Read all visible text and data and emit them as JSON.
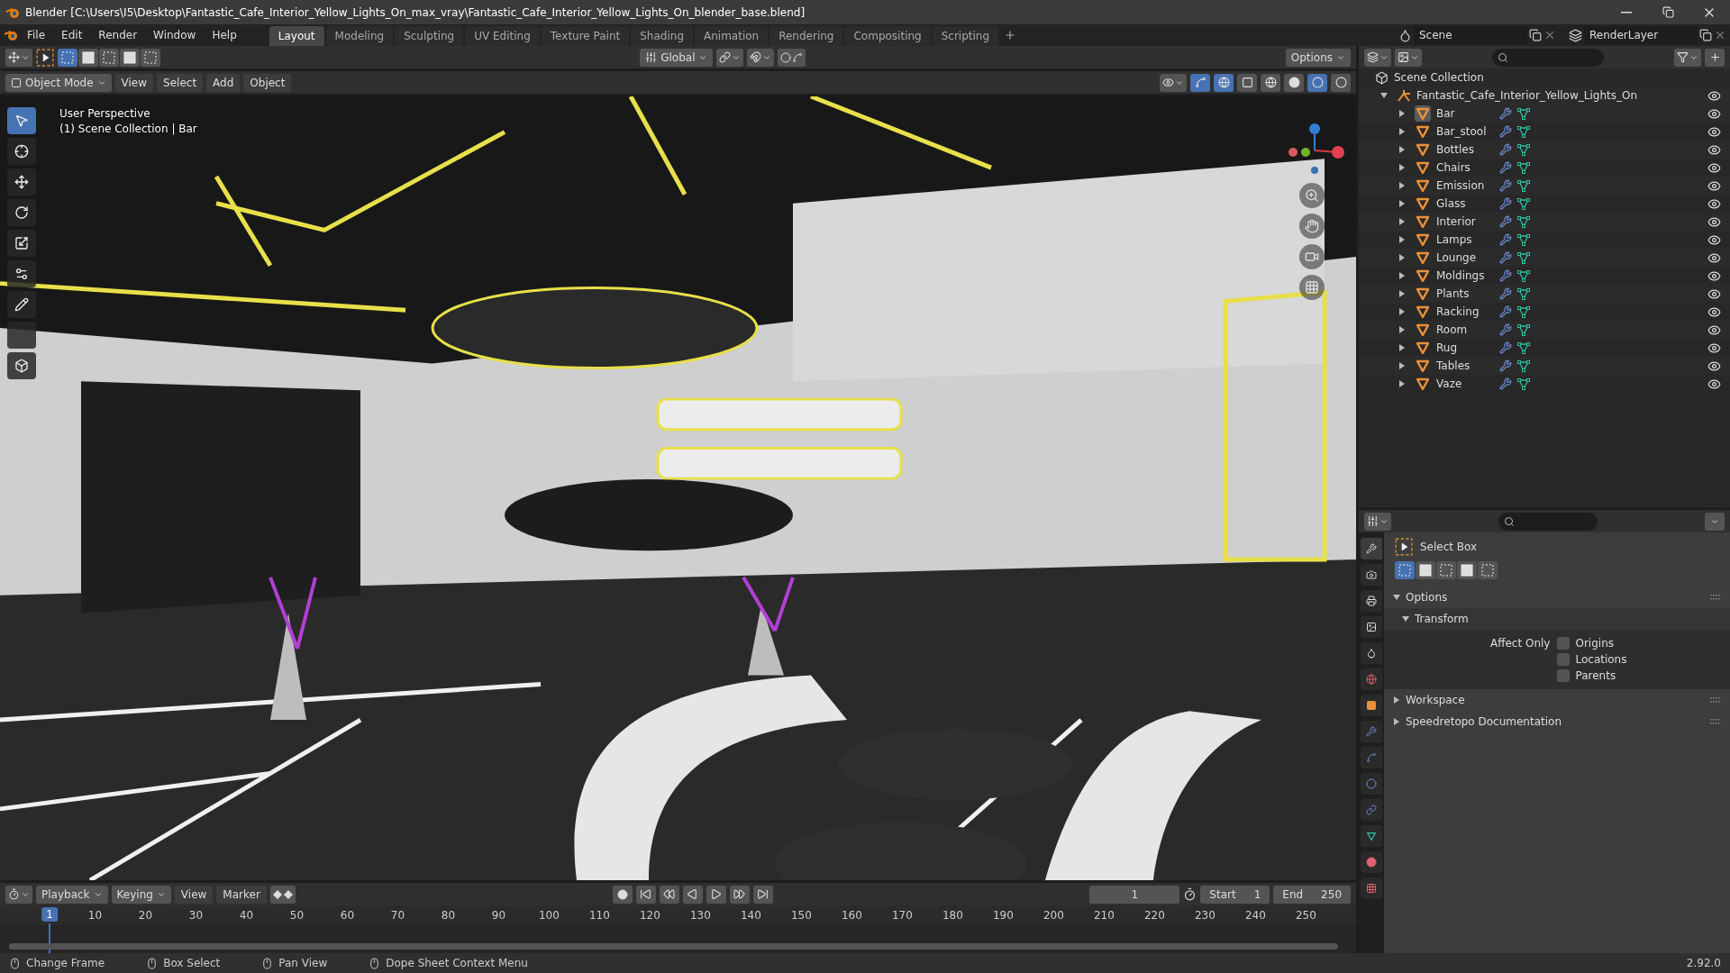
{
  "window": {
    "title": "Blender [C:\\Users\\I5\\Desktop\\Fantastic_Cafe_Interior_Yellow_Lights_On_max_vray\\Fantastic_Cafe_Interior_Yellow_Lights_On_blender_base.blend]"
  },
  "menu": [
    "File",
    "Edit",
    "Render",
    "Window",
    "Help"
  ],
  "workspaces": [
    {
      "label": "Layout",
      "selected": true
    },
    {
      "label": "Modeling",
      "selected": false
    },
    {
      "label": "Sculpting",
      "selected": false
    },
    {
      "label": "UV Editing",
      "selected": false
    },
    {
      "label": "Texture Paint",
      "selected": false
    },
    {
      "label": "Shading",
      "selected": false
    },
    {
      "label": "Animation",
      "selected": false
    },
    {
      "label": "Rendering",
      "selected": false
    },
    {
      "label": "Compositing",
      "selected": false
    },
    {
      "label": "Scripting",
      "selected": false
    }
  ],
  "scene": "Scene",
  "view_layer": "RenderLayer",
  "tool_header": {
    "orientation": "Global",
    "options": "Options"
  },
  "viewport": {
    "mode": "Object Mode",
    "menus": [
      "View",
      "Select",
      "Add",
      "Object"
    ],
    "view_name": "User Perspective",
    "context": "(1) Scene Collection | Bar"
  },
  "outliner": {
    "root": "Scene Collection",
    "collection": {
      "name": "Fantastic_Cafe_Interior_Yellow_Lights_On",
      "expanded": true,
      "children": [
        {
          "name": "Bar",
          "selected": true
        },
        {
          "name": "Bar_stool",
          "selected": false
        },
        {
          "name": "Bottles",
          "selected": false
        },
        {
          "name": "Chairs",
          "selected": false
        },
        {
          "name": "Emission",
          "selected": false
        },
        {
          "name": "Glass",
          "selected": false
        },
        {
          "name": "Interior",
          "selected": false
        },
        {
          "name": "Lamps",
          "selected": false
        },
        {
          "name": "Lounge",
          "selected": false
        },
        {
          "name": "Moldings",
          "selected": false
        },
        {
          "name": "Plants",
          "selected": false
        },
        {
          "name": "Racking",
          "selected": false
        },
        {
          "name": "Room",
          "selected": false
        },
        {
          "name": "Rug",
          "selected": false
        },
        {
          "name": "Tables",
          "selected": false
        },
        {
          "name": "Vaze",
          "selected": false
        }
      ]
    }
  },
  "properties": {
    "tool": "Select Box",
    "panels": [
      {
        "title": "Options",
        "expanded": true,
        "subpanels": [
          {
            "title": "Transform",
            "expanded": true,
            "label": "Affect Only",
            "checkboxes": [
              {
                "label": "Origins",
                "checked": false
              },
              {
                "label": "Locations",
                "checked": false
              },
              {
                "label": "Parents",
                "checked": false
              }
            ]
          }
        ]
      },
      {
        "title": "Workspace",
        "expanded": false
      },
      {
        "title": "Speedretopo Documentation",
        "expanded": false
      }
    ]
  },
  "timeline": {
    "menus": [
      {
        "label": "Playback",
        "kind": "dropdown"
      },
      {
        "label": "Keying",
        "kind": "dropdown"
      },
      {
        "label": "View",
        "kind": "menu"
      },
      {
        "label": "Marker",
        "kind": "menu"
      }
    ],
    "current_frame": "1",
    "start_label": "Start",
    "start": "1",
    "end_label": "End",
    "end": "250",
    "playhead": "1",
    "ticks": [
      "10",
      "20",
      "30",
      "40",
      "50",
      "60",
      "70",
      "80",
      "90",
      "100",
      "110",
      "120",
      "130",
      "140",
      "150",
      "160",
      "170",
      "180",
      "190",
      "200",
      "210",
      "220",
      "230",
      "240",
      "250"
    ]
  },
  "status_bar": {
    "hints": [
      "Change Frame",
      "Box Select",
      "Pan View",
      "Dope Sheet Context Menu"
    ],
    "version": "2.92.0"
  }
}
